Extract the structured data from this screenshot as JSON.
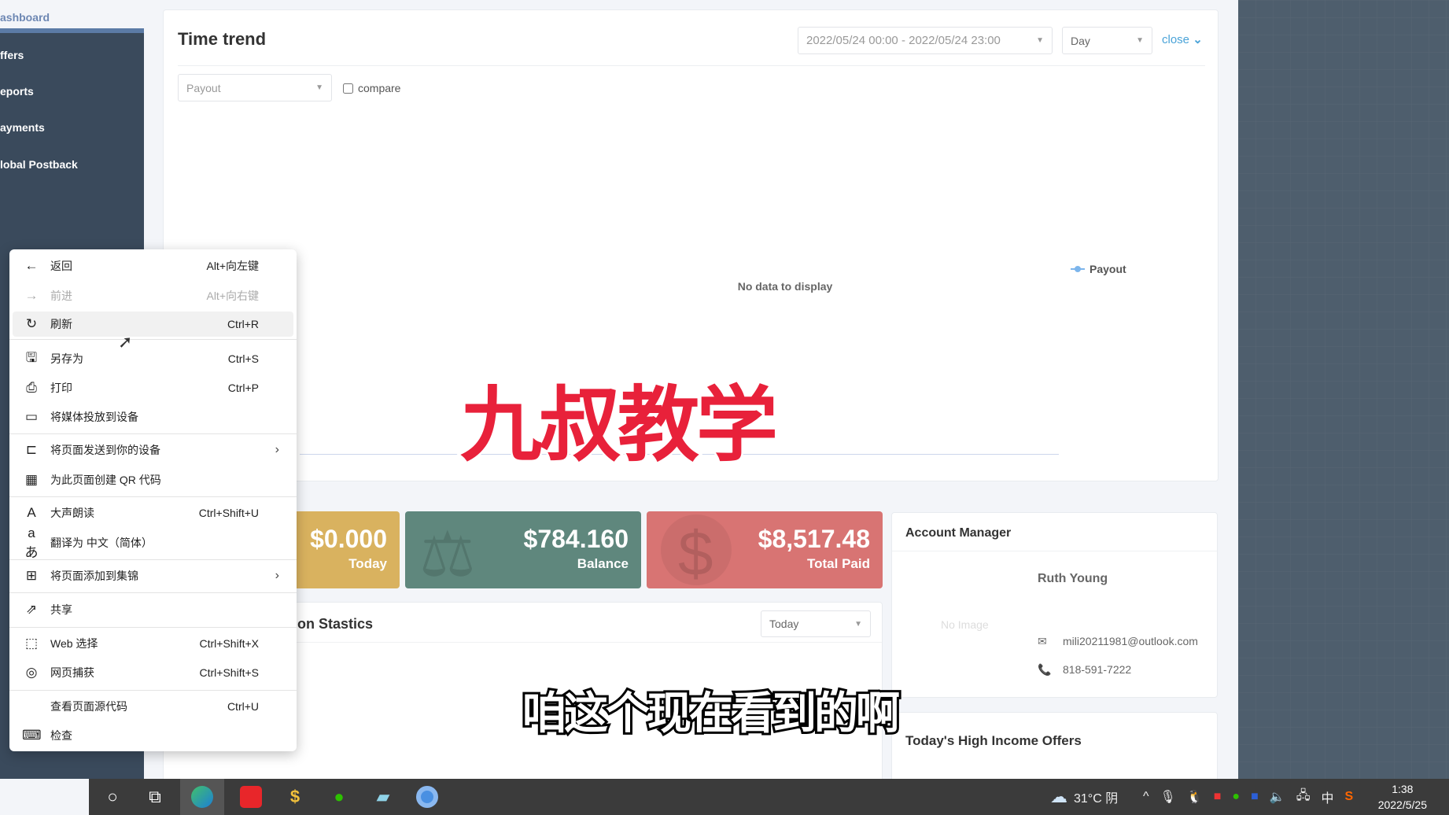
{
  "sidebar": {
    "top_label": "ashboard",
    "items": [
      "ffers",
      "eports",
      "ayments",
      "lobal Postback"
    ]
  },
  "trend": {
    "title": "Time trend",
    "date_range": "2022/05/24 00:00 - 2022/05/24 23:00",
    "granularity": "Day",
    "close_label": "close",
    "metric": "Payout",
    "compare_label": "compare",
    "no_data": "No data to display",
    "legend": "Payout"
  },
  "stats": [
    {
      "value": "$0.000",
      "label": "Today",
      "color": "#d9b25f"
    },
    {
      "value": "$784.160",
      "label": "Balance",
      "color": "#5f877d"
    },
    {
      "value": "$8,517.48",
      "label": "Total Paid",
      "color": "#d87473"
    }
  ],
  "conversion": {
    "title": "on Stastics",
    "period": "Today"
  },
  "account_manager": {
    "title": "Account Manager",
    "name": "Ruth Young",
    "no_image": "No Image",
    "email": "mili20211981@outlook.com",
    "phone": "818-591-7222"
  },
  "offers": {
    "title": "Today's High Income Offers"
  },
  "context_menu": [
    {
      "icon": "arrow-left",
      "label": "返回",
      "shortcut": "Alt+向左键"
    },
    {
      "icon": "arrow-right",
      "label": "前进",
      "shortcut": "Alt+向右键",
      "disabled": true
    },
    {
      "icon": "refresh",
      "label": "刷新",
      "shortcut": "Ctrl+R",
      "hover": true
    },
    {
      "icon": "save",
      "label": "另存为",
      "shortcut": "Ctrl+S"
    },
    {
      "icon": "print",
      "label": "打印",
      "shortcut": "Ctrl+P"
    },
    {
      "icon": "cast",
      "label": "将媒体投放到设备",
      "shortcut": ""
    },
    {
      "icon": "send-device",
      "label": "将页面发送到你的设备",
      "shortcut": "",
      "submenu": true
    },
    {
      "icon": "qr-code",
      "label": "为此页面创建 QR 代码",
      "shortcut": ""
    },
    {
      "icon": "read-aloud",
      "label": "大声朗读",
      "shortcut": "Ctrl+Shift+U"
    },
    {
      "icon": "translate",
      "label": "翻译为 中文（简体）",
      "shortcut": ""
    },
    {
      "icon": "collections",
      "label": "将页面添加到集锦",
      "shortcut": "",
      "submenu": true
    },
    {
      "icon": "share",
      "label": "共享",
      "shortcut": ""
    },
    {
      "icon": "web-select",
      "label": "Web 选择",
      "shortcut": "Ctrl+Shift+X"
    },
    {
      "icon": "web-capture",
      "label": "网页捕获",
      "shortcut": "Ctrl+Shift+S"
    },
    {
      "icon": "",
      "label": "查看页面源代码",
      "shortcut": "Ctrl+U"
    },
    {
      "icon": "inspect",
      "label": "检查",
      "shortcut": ""
    }
  ],
  "subtitles": {
    "watermark": "九叔教学",
    "caption": "咱这个现在看到的啊"
  },
  "taskbar": {
    "weather": "31°C 阴",
    "ime": "中",
    "time": "1:38",
    "date": "2022/5/25"
  }
}
